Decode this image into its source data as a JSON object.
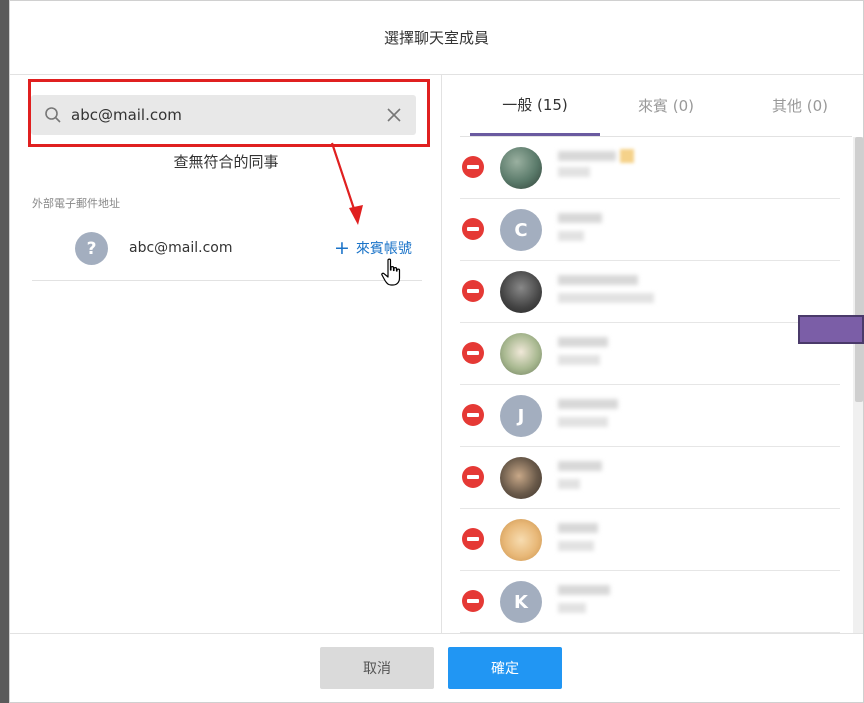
{
  "dialog": {
    "title": "選擇聊天室成員"
  },
  "search": {
    "value": "abc@mail.com",
    "no_match_text": "查無符合的同事"
  },
  "external": {
    "section_label": "外部電子郵件地址",
    "avatar_glyph": "?",
    "email": "abc@mail.com",
    "add_guest_label": "來賓帳號",
    "add_guest_icon": "plus-icon"
  },
  "tabs": [
    {
      "label": "一般 (15)",
      "active": true
    },
    {
      "label": "來賓 (0)",
      "active": false
    },
    {
      "label": "其他  (0)",
      "active": false
    }
  ],
  "members": [
    {
      "avatar_type": "photo",
      "avatar_letter": "",
      "color": "#5a7a6a"
    },
    {
      "avatar_type": "letter",
      "avatar_letter": "C",
      "color": "#a3aebf"
    },
    {
      "avatar_type": "photo",
      "avatar_letter": "",
      "color": "#4a4a4a"
    },
    {
      "avatar_type": "photo",
      "avatar_letter": "",
      "color": "#8aa07a"
    },
    {
      "avatar_type": "letter",
      "avatar_letter": "J",
      "color": "#a3aebf"
    },
    {
      "avatar_type": "photo",
      "avatar_letter": "",
      "color": "#6a5a4a"
    },
    {
      "avatar_type": "photo",
      "avatar_letter": "",
      "color": "#d9a560"
    },
    {
      "avatar_type": "letter",
      "avatar_letter": "K",
      "color": "#a3aebf"
    }
  ],
  "footer": {
    "cancel_label": "取消",
    "confirm_label": "確定"
  },
  "colors": {
    "accent_blue": "#2196f3",
    "link_blue": "#1a73c8",
    "remove_red": "#e53935",
    "highlight_red": "#e02020",
    "tab_underline": "#6a5aa0",
    "chip_purple": "#7b5ea7"
  }
}
